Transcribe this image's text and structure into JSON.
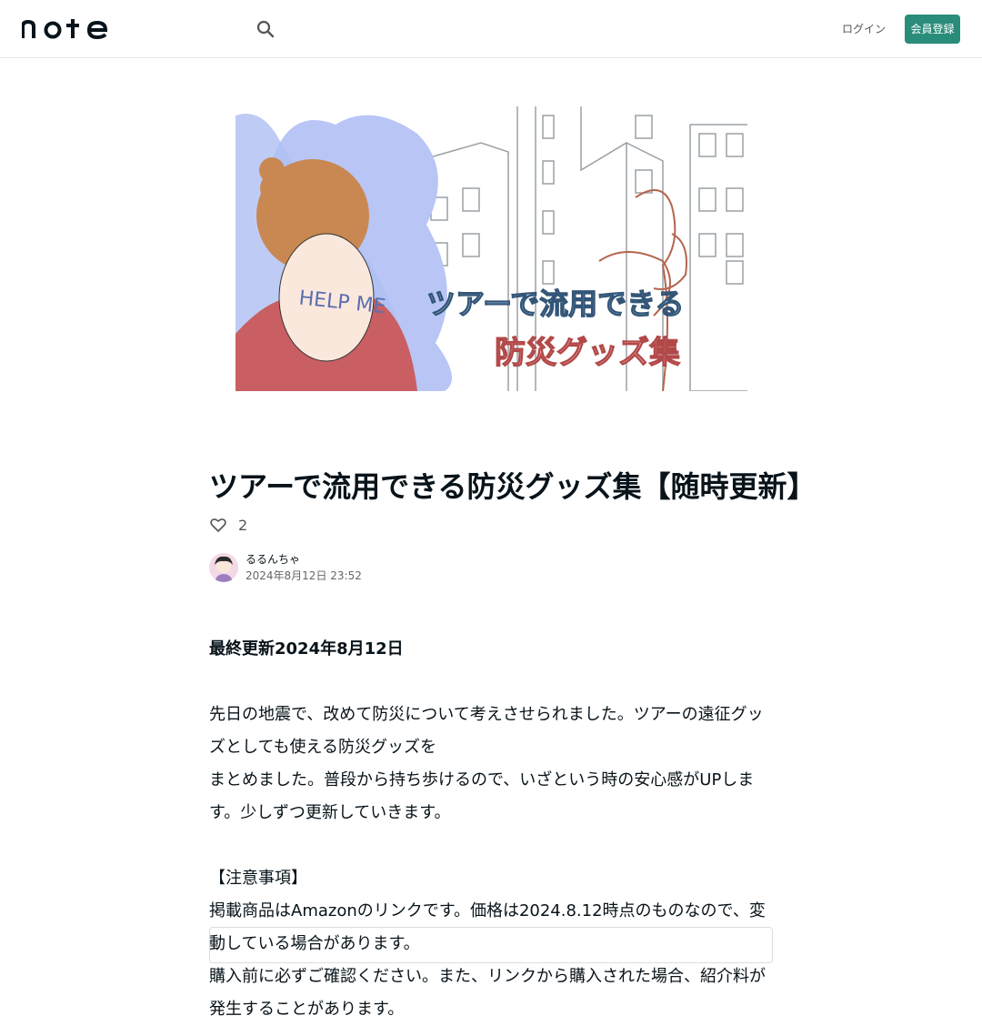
{
  "header": {
    "logo_text": "note",
    "search_icon": "search-icon",
    "login_label": "ログイン",
    "signup_label": "会員登録",
    "accent_color": "#2a8c7a"
  },
  "hero": {
    "title_line1": "ツアーで流用できる",
    "title_line2": "防災グッズ集",
    "sign_text": "HELP ME"
  },
  "article": {
    "title": "ツアーで流用できる防災グッズ集【随時更新】",
    "like_count": "2",
    "author_name": "るるんちゃ",
    "post_date": "2024年8月12日 23:52",
    "updated": "最終更新2024年8月12日",
    "para1_line1": "先日の地震で、改めて防災について考えさせられました。ツアーの遠征グッズとしても使える防災グッズを",
    "para1_line2": "まとめました。普段から持ち歩けるので、いざという時の安心感がUPします。少しずつ更新していきます。",
    "note_heading": "【注意事項】",
    "para2_line1": "掲載商品はAmazonのリンクです。価格は2024.8.12時点のものなので、変動している場合があります。",
    "para2_line2": "購入前に必ずご確認ください。また、リンクから購入された場合、紹介料が発生することがあります。"
  }
}
